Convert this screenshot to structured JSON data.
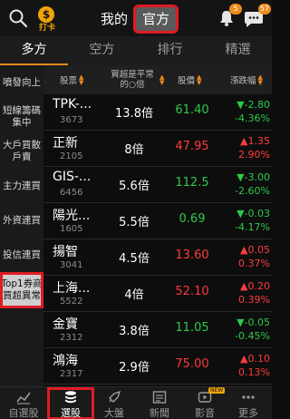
{
  "header": {
    "checkin_glyph": "$",
    "checkin_label": "打卡",
    "segments": [
      "我的",
      "官方"
    ],
    "active_segment": "官方",
    "bell_badge": "5",
    "chat_badge": "57"
  },
  "tabs": [
    "多方",
    "空方",
    "排行",
    "精選"
  ],
  "active_tab": "多方",
  "sidebar": {
    "items": [
      "噴發向上",
      "短線籌碼集中",
      "大戶買散戶賣",
      "主力連買",
      "外資連買",
      "投信連買",
      "Top1券商買超異常"
    ],
    "active": "Top1券商買超異常"
  },
  "table": {
    "headers": [
      "股票",
      "買超是平常的○倍",
      "股價",
      "漲跌幅"
    ],
    "rows": [
      {
        "name": "TPK-...",
        "code": "3673",
        "multiple": "13.8倍",
        "price": "61.40",
        "change": "▼-2.80",
        "pct": "-4.36%",
        "dir": "down"
      },
      {
        "name": "正新",
        "code": "2105",
        "multiple": "8倍",
        "price": "47.95",
        "change": "▲1.35",
        "pct": "2.90%",
        "dir": "up"
      },
      {
        "name": "GIS-...",
        "code": "6456",
        "multiple": "5.6倍",
        "price": "112.5",
        "change": "▼-3.00",
        "pct": "-2.60%",
        "dir": "down"
      },
      {
        "name": "陽光...",
        "code": "1605",
        "multiple": "5.5倍",
        "price": "0.69",
        "change": "▼-0.03",
        "pct": "-4.17%",
        "dir": "down"
      },
      {
        "name": "揚智",
        "code": "3041",
        "multiple": "4.5倍",
        "price": "13.60",
        "change": "▲0.05",
        "pct": "0.37%",
        "dir": "up"
      },
      {
        "name": "上海...",
        "code": "5522",
        "multiple": "4倍",
        "price": "52.10",
        "change": "▲0.20",
        "pct": "0.39%",
        "dir": "up"
      },
      {
        "name": "金寶",
        "code": "2312",
        "multiple": "3.8倍",
        "price": "11.05",
        "change": "▼-0.05",
        "pct": "-0.45%",
        "dir": "down"
      },
      {
        "name": "鴻海",
        "code": "2317",
        "multiple": "2.9倍",
        "price": "75.00",
        "change": "▲0.10",
        "pct": "0.13%",
        "dir": "up"
      }
    ]
  },
  "bottom_nav": {
    "items": [
      {
        "label": "自選股",
        "icon": "watchlist-chart-icon"
      },
      {
        "label": "選股",
        "icon": "stock-pick-stack-icon"
      },
      {
        "label": "大盤",
        "icon": "market-rocket-icon"
      },
      {
        "label": "新聞",
        "icon": "news-icon"
      },
      {
        "label": "影音",
        "icon": "video-icon"
      },
      {
        "label": "更多",
        "icon": "more-dots-icon"
      }
    ],
    "active": "選股",
    "new_tag": "NEW"
  },
  "colors": {
    "up": "#ff3b3b",
    "down": "#2ec94b",
    "accent": "#f08a1c",
    "highlight": "#e01b24"
  }
}
